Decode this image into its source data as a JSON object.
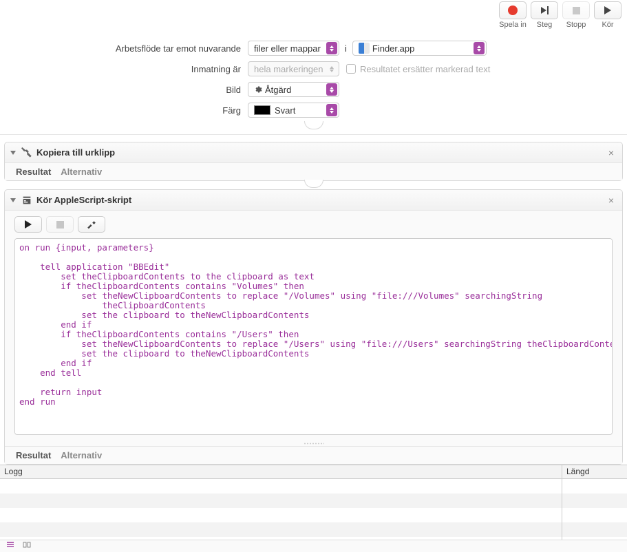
{
  "toolbar": {
    "record": "Spela in",
    "step": "Steg",
    "stop": "Stopp",
    "run": "Kör"
  },
  "config": {
    "workflow_receives_label": "Arbetsflöde tar emot nuvarande",
    "workflow_receives_value": "filer eller mappar",
    "i": "i",
    "app_value": "Finder.app",
    "input_is_label": "Inmatning är",
    "input_is_value": "hela markeringen",
    "result_replaces_label": "Resultatet ersätter markerad text",
    "image_label": "Bild",
    "image_value": "Åtgärd",
    "color_label": "Färg",
    "color_value": "Svart"
  },
  "action1": {
    "title": "Kopiera till urklipp",
    "tab_result": "Resultat",
    "tab_options": "Alternativ"
  },
  "action2": {
    "title": "Kör AppleScript-skript",
    "tab_result": "Resultat",
    "tab_options": "Alternativ",
    "code": "on run {input, parameters}\n\n    tell application \"BBEdit\"\n        set theClipboardContents to the clipboard as text\n        if theClipboardContents contains \"Volumes\" then\n            set theNewClipboardContents to replace \"/Volumes\" using \"file:///Volumes\" searchingString\n                theClipboardContents\n            set the clipboard to theNewClipboardContents\n        end if\n        if theClipboardContents contains \"/Users\" then\n            set theNewClipboardContents to replace \"/Users\" using \"file:///Users\" searchingString theClipboardContents\n            set the clipboard to theNewClipboardContents\n        end if\n    end tell\n\n    return input\nend run"
  },
  "log": {
    "header_left": "Logg",
    "header_right": "Längd"
  }
}
